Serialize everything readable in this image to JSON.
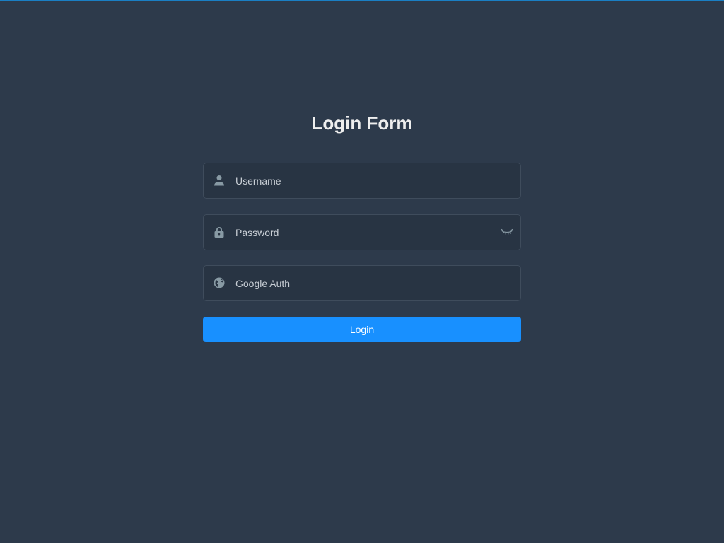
{
  "page": {
    "title": "Login Form"
  },
  "form": {
    "username": {
      "value": "",
      "placeholder": "Username",
      "icon": "user-icon"
    },
    "password": {
      "value": "",
      "placeholder": "Password",
      "icon": "lock-icon",
      "toggle_icon": "eye-closed-icon"
    },
    "google_auth": {
      "value": "",
      "placeholder": "Google Auth",
      "icon": "globe-icon"
    },
    "submit_label": "Login"
  },
  "colors": {
    "background": "#2d3a4b",
    "field_background": "#283443",
    "accent": "#1890ff",
    "top_bar": "#1a7fc4"
  }
}
